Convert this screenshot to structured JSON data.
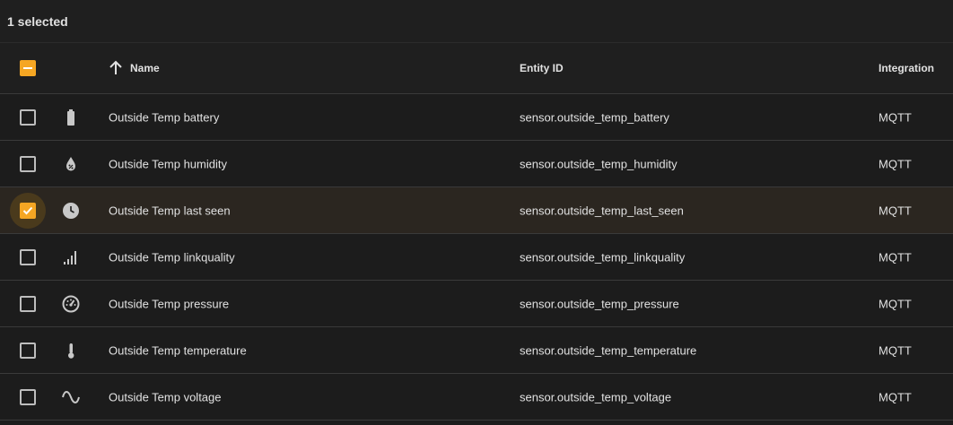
{
  "toolbar": {
    "selection_text": "1 selected"
  },
  "table": {
    "columns": {
      "name": "Name",
      "entity_id": "Entity ID",
      "integration": "Integration"
    },
    "sort_icon": "arrow-up-icon",
    "header_checkbox_state": "indeterminate",
    "accent_color": "#f5a623",
    "rows": [
      {
        "icon": "battery-icon",
        "name": "Outside Temp battery",
        "entity_id": "sensor.outside_temp_battery",
        "integration": "MQTT",
        "selected": false
      },
      {
        "icon": "water-percent-icon",
        "name": "Outside Temp humidity",
        "entity_id": "sensor.outside_temp_humidity",
        "integration": "MQTT",
        "selected": false
      },
      {
        "icon": "clock-icon",
        "name": "Outside Temp last seen",
        "entity_id": "sensor.outside_temp_last_seen",
        "integration": "MQTT",
        "selected": true
      },
      {
        "icon": "signal-icon",
        "name": "Outside Temp linkquality",
        "entity_id": "sensor.outside_temp_linkquality",
        "integration": "MQTT",
        "selected": false
      },
      {
        "icon": "gauge-icon",
        "name": "Outside Temp pressure",
        "entity_id": "sensor.outside_temp_pressure",
        "integration": "MQTT",
        "selected": false
      },
      {
        "icon": "thermometer-icon",
        "name": "Outside Temp temperature",
        "entity_id": "sensor.outside_temp_temperature",
        "integration": "MQTT",
        "selected": false
      },
      {
        "icon": "sine-wave-icon",
        "name": "Outside Temp voltage",
        "entity_id": "sensor.outside_temp_voltage",
        "integration": "MQTT",
        "selected": false
      }
    ]
  }
}
